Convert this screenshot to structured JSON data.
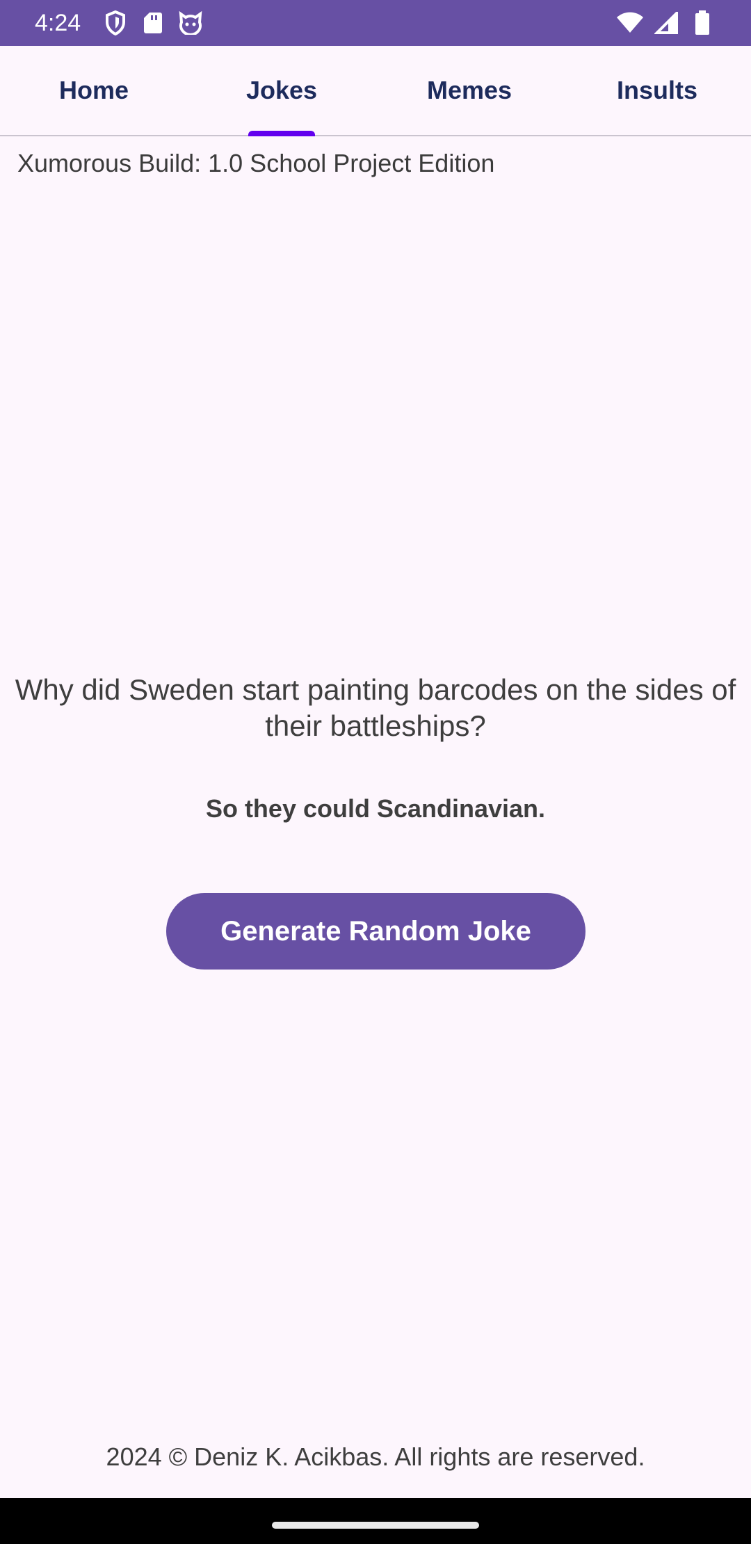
{
  "status_bar": {
    "time": "4:24",
    "icons_left": [
      "shield-icon",
      "sd-card-icon",
      "cat-face-icon"
    ],
    "icons_right": [
      "wifi-icon",
      "signal-icon",
      "battery-icon"
    ]
  },
  "tabs": [
    {
      "label": "Home",
      "selected": false
    },
    {
      "label": "Jokes",
      "selected": true
    },
    {
      "label": "Memes",
      "selected": false
    },
    {
      "label": "Insults",
      "selected": false
    }
  ],
  "build_info": "Xumorous Build: 1.0 School Project Edition",
  "joke": {
    "question": "Why did Sweden start painting barcodes on the sides of their battleships?",
    "punchline": "So they could Scandinavian."
  },
  "button": {
    "label": "Generate Random Joke"
  },
  "footer": "2024 © Deniz K. Acikbas. All rights are reserved.",
  "colors": {
    "primary": "#6750A4",
    "tab_indicator": "#6200EE",
    "background": "#FDF6FD",
    "tab_text": "#1D2B5C"
  }
}
